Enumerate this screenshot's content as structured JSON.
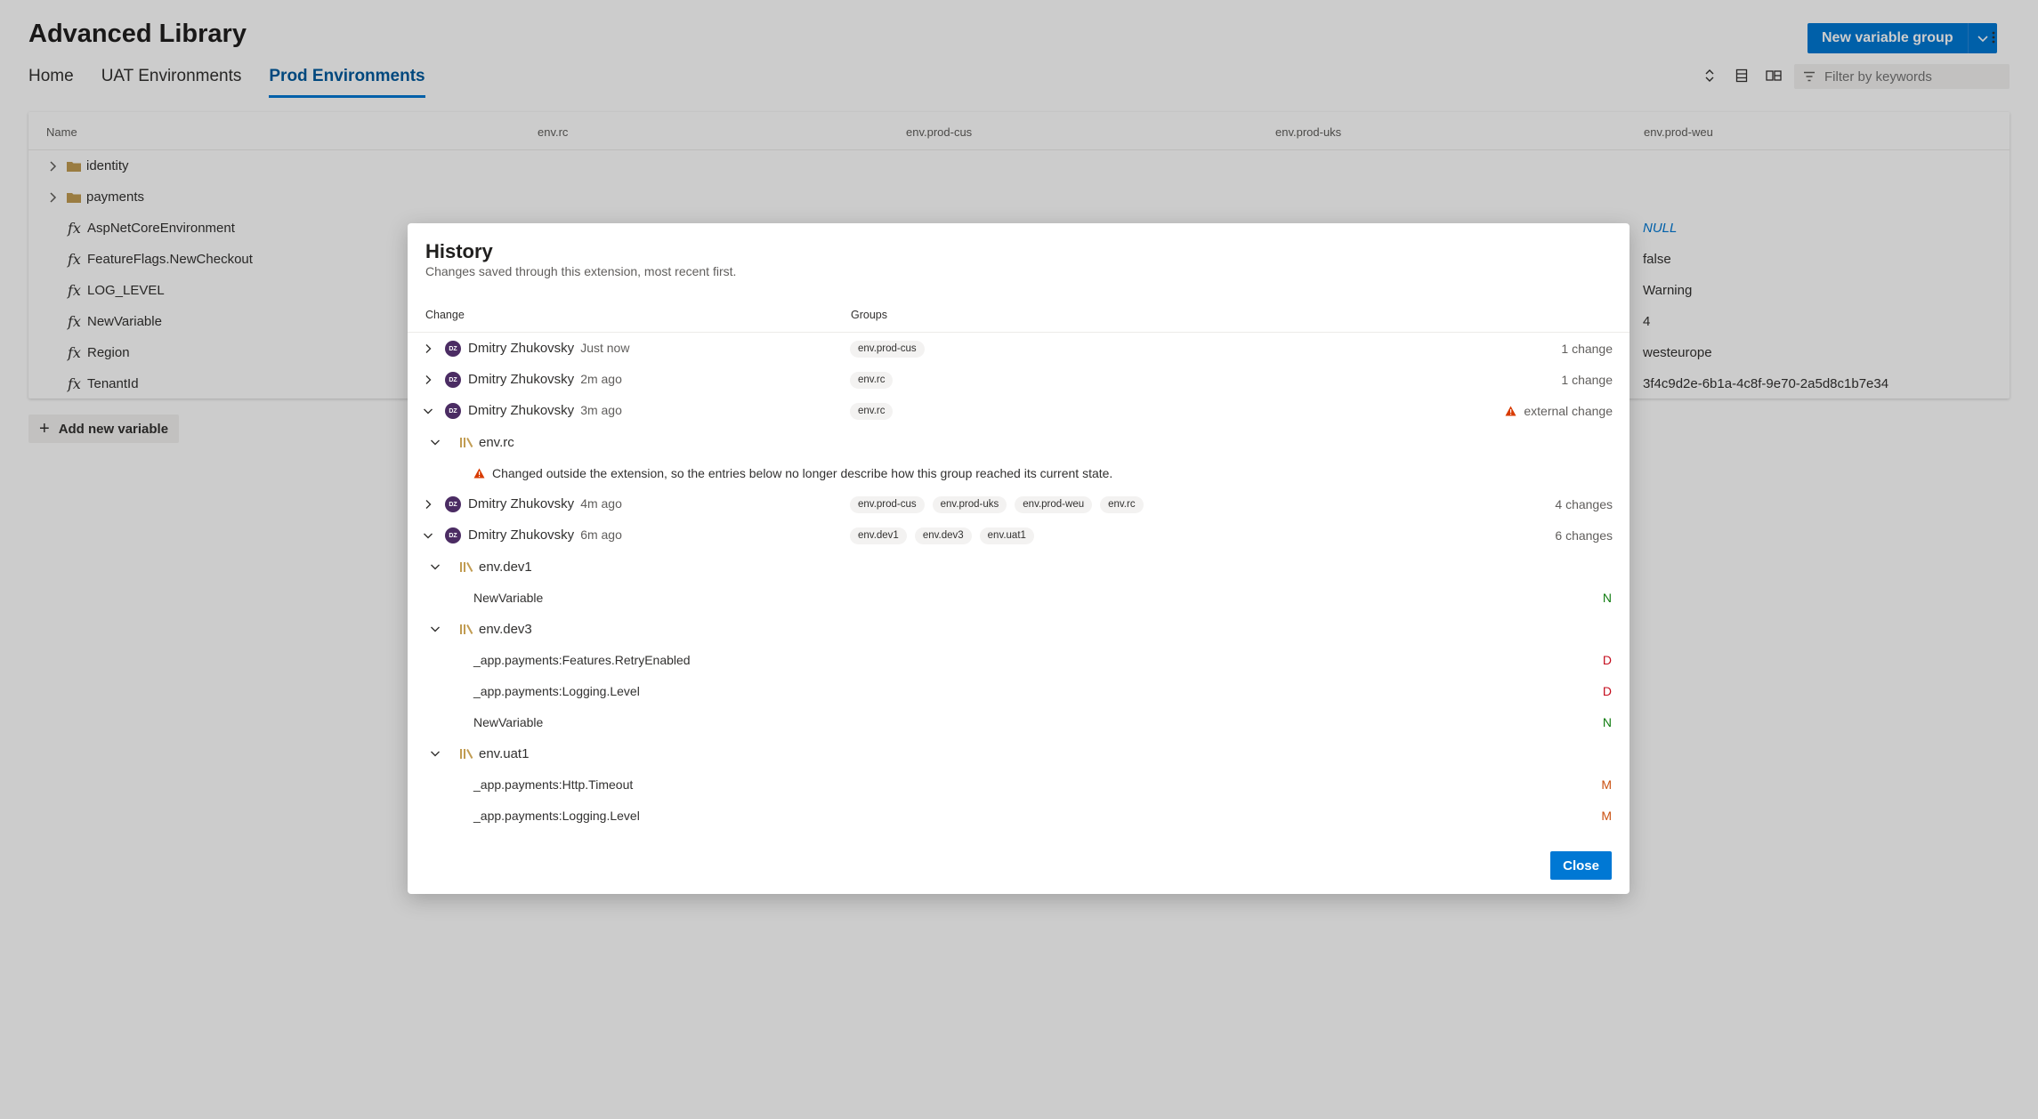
{
  "page": {
    "title": "Advanced Library",
    "tabs": [
      "Home",
      "UAT Environments",
      "Prod Environments"
    ],
    "active_tab": "Prod Environments",
    "new_group_label": "New variable group",
    "filter_placeholder": "Filter by keywords",
    "add_variable_label": "Add new variable"
  },
  "grid": {
    "columns": [
      "Name",
      "env.rc",
      "env.prod-cus",
      "env.prod-uks",
      "env.prod-weu"
    ],
    "rows": [
      {
        "name": "identity",
        "kind": "folder",
        "value": ""
      },
      {
        "name": "payments",
        "kind": "folder",
        "value": ""
      },
      {
        "name": "AspNetCoreEnvironment",
        "kind": "var",
        "value": "NULL"
      },
      {
        "name": "FeatureFlags.NewCheckout",
        "kind": "var",
        "value": "false"
      },
      {
        "name": "LOG_LEVEL",
        "kind": "var",
        "value": "Warning"
      },
      {
        "name": "NewVariable",
        "kind": "var",
        "value": "4"
      },
      {
        "name": "Region",
        "kind": "var",
        "value": "westeurope"
      },
      {
        "name": "TenantId",
        "kind": "var",
        "value": "3f4c9d2e-6b1a-4c8f-9e70-2a5d8c1b7e34"
      }
    ]
  },
  "dialog": {
    "title": "History",
    "subtitle": "Changes saved through this extension, most recent first.",
    "col_change": "Change",
    "col_groups": "Groups",
    "close_label": "Close",
    "avatar_initials": "DZ",
    "entries": [
      {
        "author": "Dmitry Zhukovsky",
        "when": "Just now",
        "groups": [
          "env.prod-cus"
        ],
        "summary": "1 change",
        "expanded": false
      },
      {
        "author": "Dmitry Zhukovsky",
        "when": "2m ago",
        "groups": [
          "env.rc"
        ],
        "summary": "1 change",
        "expanded": false
      },
      {
        "author": "Dmitry Zhukovsky",
        "when": "3m ago",
        "groups": [
          "env.rc"
        ],
        "summary": "external change",
        "expanded": true,
        "external": true,
        "details": [
          {
            "group": "env.rc",
            "warning": "Changed outside the extension, so the entries below no longer describe how this group reached its current state."
          }
        ]
      },
      {
        "author": "Dmitry Zhukovsky",
        "when": "4m ago",
        "groups": [
          "env.prod-cus",
          "env.prod-uks",
          "env.prod-weu",
          "env.rc"
        ],
        "summary": "4 changes",
        "expanded": false
      },
      {
        "author": "Dmitry Zhukovsky",
        "when": "6m ago",
        "groups": [
          "env.dev1",
          "env.dev3",
          "env.uat1"
        ],
        "summary": "6 changes",
        "expanded": true,
        "details": [
          {
            "group": "env.dev1",
            "vars": [
              {
                "name": "NewVariable",
                "op": "N"
              }
            ]
          },
          {
            "group": "env.dev3",
            "vars": [
              {
                "name": "_app.payments:Features.RetryEnabled",
                "op": "D"
              },
              {
                "name": "_app.payments:Logging.Level",
                "op": "D"
              },
              {
                "name": "NewVariable",
                "op": "N"
              }
            ]
          },
          {
            "group": "env.uat1",
            "vars": [
              {
                "name": "_app.payments:Http.Timeout",
                "op": "M"
              },
              {
                "name": "_app.payments:Logging.Level",
                "op": "M"
              }
            ]
          }
        ]
      }
    ]
  },
  "colors": {
    "accent": "#0078d4",
    "avatar": "#4b2c63",
    "folder": "#c19c52",
    "new": "#107c10",
    "deleted": "#c50f1f",
    "modified": "#ca5010",
    "warning": "#d83b01"
  }
}
